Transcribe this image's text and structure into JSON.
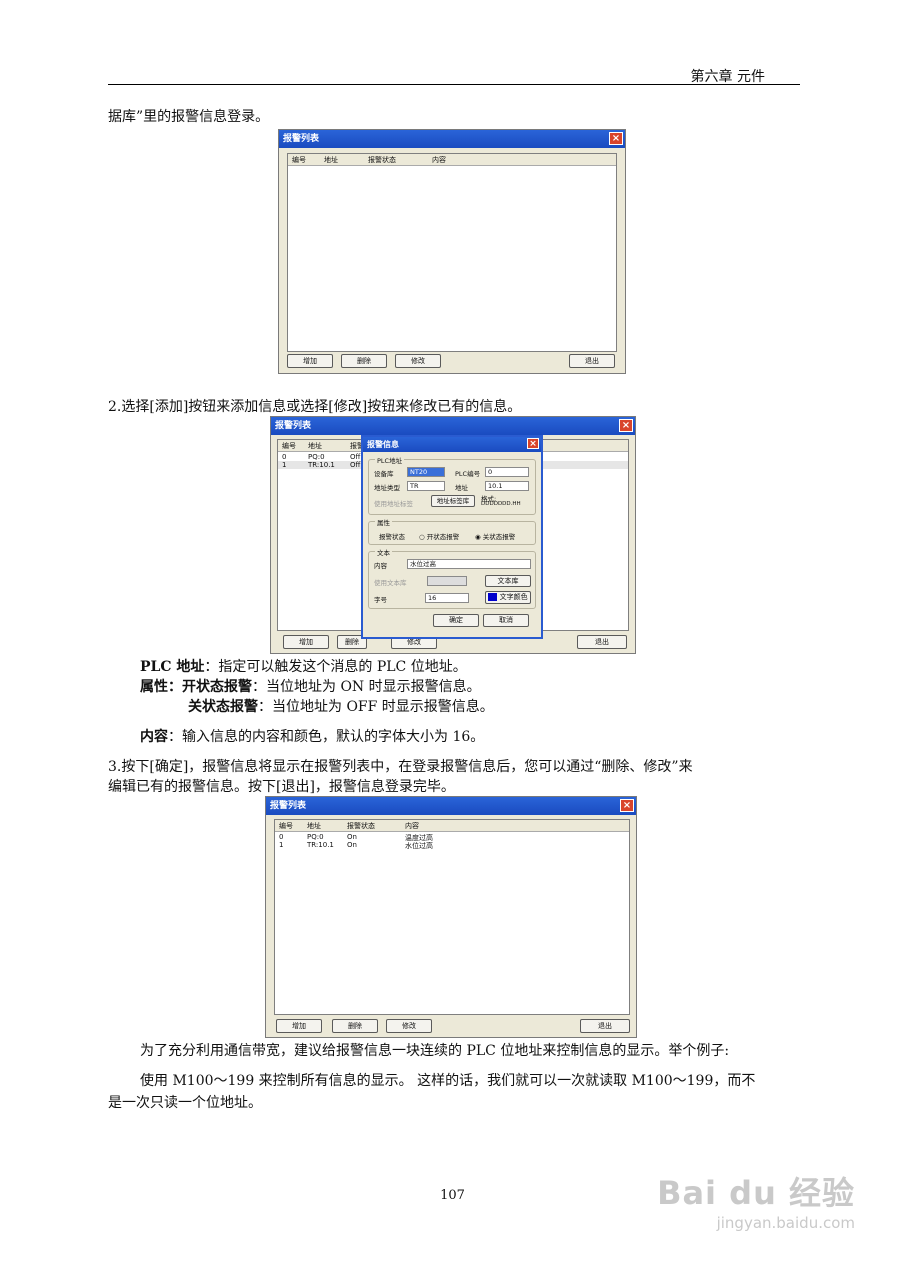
{
  "header": {
    "chapter": "第六章  元件"
  },
  "text": {
    "p1": "据库”里的报警信息登录。",
    "p2": "2.选择[添加]按钮来添加信息或选择[修改]按钮来修改已有的信息。",
    "plc_label": "PLC 地址",
    "plc_desc": "：指定可以触发这个消息的 PLC 位地址。",
    "attr_label": "属性：",
    "on_label": "开状态报警",
    "on_desc": "：当位地址为 ON 时显示报警信息。",
    "off_label": "关状态报警",
    "off_desc": "：当位地址为 OFF 时显示报警信息。",
    "content_label": "内容",
    "content_desc": "：输入信息的内容和颜色，默认的字体大小为 16。",
    "p3a": "3.按下[确定]，报警信息将显示在报警列表中，在登录报警信息后，您可以通过“删除、修改”来",
    "p3b": "编辑已有的报警信息。按下[退出]，报警信息登录完毕。",
    "p4": "为了充分利用通信带宽，建议给报警信息一块连续的 PLC 位地址来控制信息的显示。举个例子:",
    "p5a": "使用 M100～199 来控制所有信息的显示。 这样的话，我们就可以一次就读取 M100～199，而不",
    "p5b": "是一次只读一个位地址。"
  },
  "alarm_window": {
    "title": "报警列表",
    "close": "×",
    "columns": [
      "编号",
      "地址",
      "报警状态",
      "内容"
    ],
    "buttons": {
      "add": "增加",
      "delete": "删除",
      "modify": "修改",
      "exit": "退出"
    }
  },
  "window2_rows": [
    {
      "no": "0",
      "addr": "PQ:0",
      "state": "Off"
    },
    {
      "no": "1",
      "addr": "TR:10.1",
      "state": "Off"
    }
  ],
  "window3_rows": [
    {
      "no": "0",
      "addr": "PQ:0",
      "state": "On",
      "content": "温度过高"
    },
    {
      "no": "1",
      "addr": "TR:10.1",
      "state": "On",
      "content": "水位过高"
    }
  ],
  "dialog": {
    "title": "报警信息",
    "plc_group": "PLC地址",
    "dev_label": "设备库",
    "dev_value": "NT20",
    "plc_no_label": "PLC编号",
    "plc_no_value": "0",
    "addr_type_label": "地址类型",
    "addr_type_value": "TR",
    "addr_label": "地址",
    "addr_value": "10.1",
    "use_tag_label": "使用地址标签",
    "tag_db_btn": "地址标签库",
    "format_label": "格式:",
    "format_value": "DDDDDDD.HH",
    "attr_group": "属性",
    "alarm_state_label": "报警状态",
    "on_option": "开状态报警",
    "off_option": "关状态报警",
    "text_group": "文本",
    "content_label": "内容",
    "content_value": "水位过高",
    "use_textlib_label": "使用文本库",
    "textlib_btn": "文本库",
    "font_label": "字号",
    "font_value": "16",
    "font_color_btn": "文字颜色",
    "ok": "确定",
    "cancel": "取消",
    "color": "#0000cc"
  },
  "page_number": "107",
  "watermark": {
    "brand": "Bai du 经验",
    "url": "jingyan.baidu.com"
  }
}
